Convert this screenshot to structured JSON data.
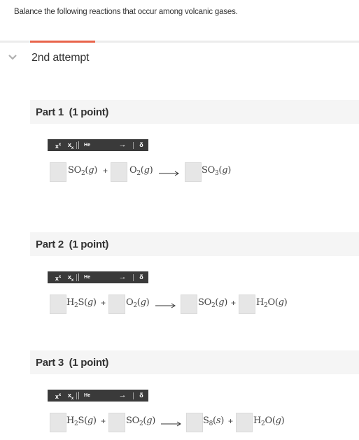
{
  "prompt": "Balance the following reactions that occur among volcanic gases.",
  "attempt": {
    "title": "2nd attempt",
    "accent_color": "#e8644a"
  },
  "toolbar": {
    "superscript": "x",
    "subscript": "x",
    "he": "He",
    "arrow": "→",
    "delta": "δ"
  },
  "parts": [
    {
      "title": "Part 1",
      "points": "(1 point)",
      "reactants": [
        {
          "formula": "SO",
          "sub": "2",
          "state": "g"
        },
        {
          "formula": "O",
          "sub": "2",
          "state": "g"
        }
      ],
      "products": [
        {
          "formula": "SO",
          "sub": "3",
          "state": "g"
        }
      ]
    },
    {
      "title": "Part 2",
      "points": "(1 point)",
      "reactants": [
        {
          "formula": "H",
          "sub": "2",
          "tail": "S",
          "state": "g"
        },
        {
          "formula": "O",
          "sub": "2",
          "state": "g"
        }
      ],
      "products": [
        {
          "formula": "SO",
          "sub": "2",
          "state": "g"
        },
        {
          "formula": "H",
          "sub": "2",
          "tail": "O",
          "state": "g"
        }
      ]
    },
    {
      "title": "Part 3",
      "points": "(1 point)",
      "reactants": [
        {
          "formula": "H",
          "sub": "2",
          "tail": "S",
          "state": "g"
        },
        {
          "formula": "SO",
          "sub": "2",
          "state": "g"
        }
      ],
      "products": [
        {
          "formula": "S",
          "sub": "8",
          "state": "s"
        },
        {
          "formula": "H",
          "sub": "2",
          "tail": "O",
          "state": "g"
        }
      ]
    }
  ],
  "operator": "+"
}
